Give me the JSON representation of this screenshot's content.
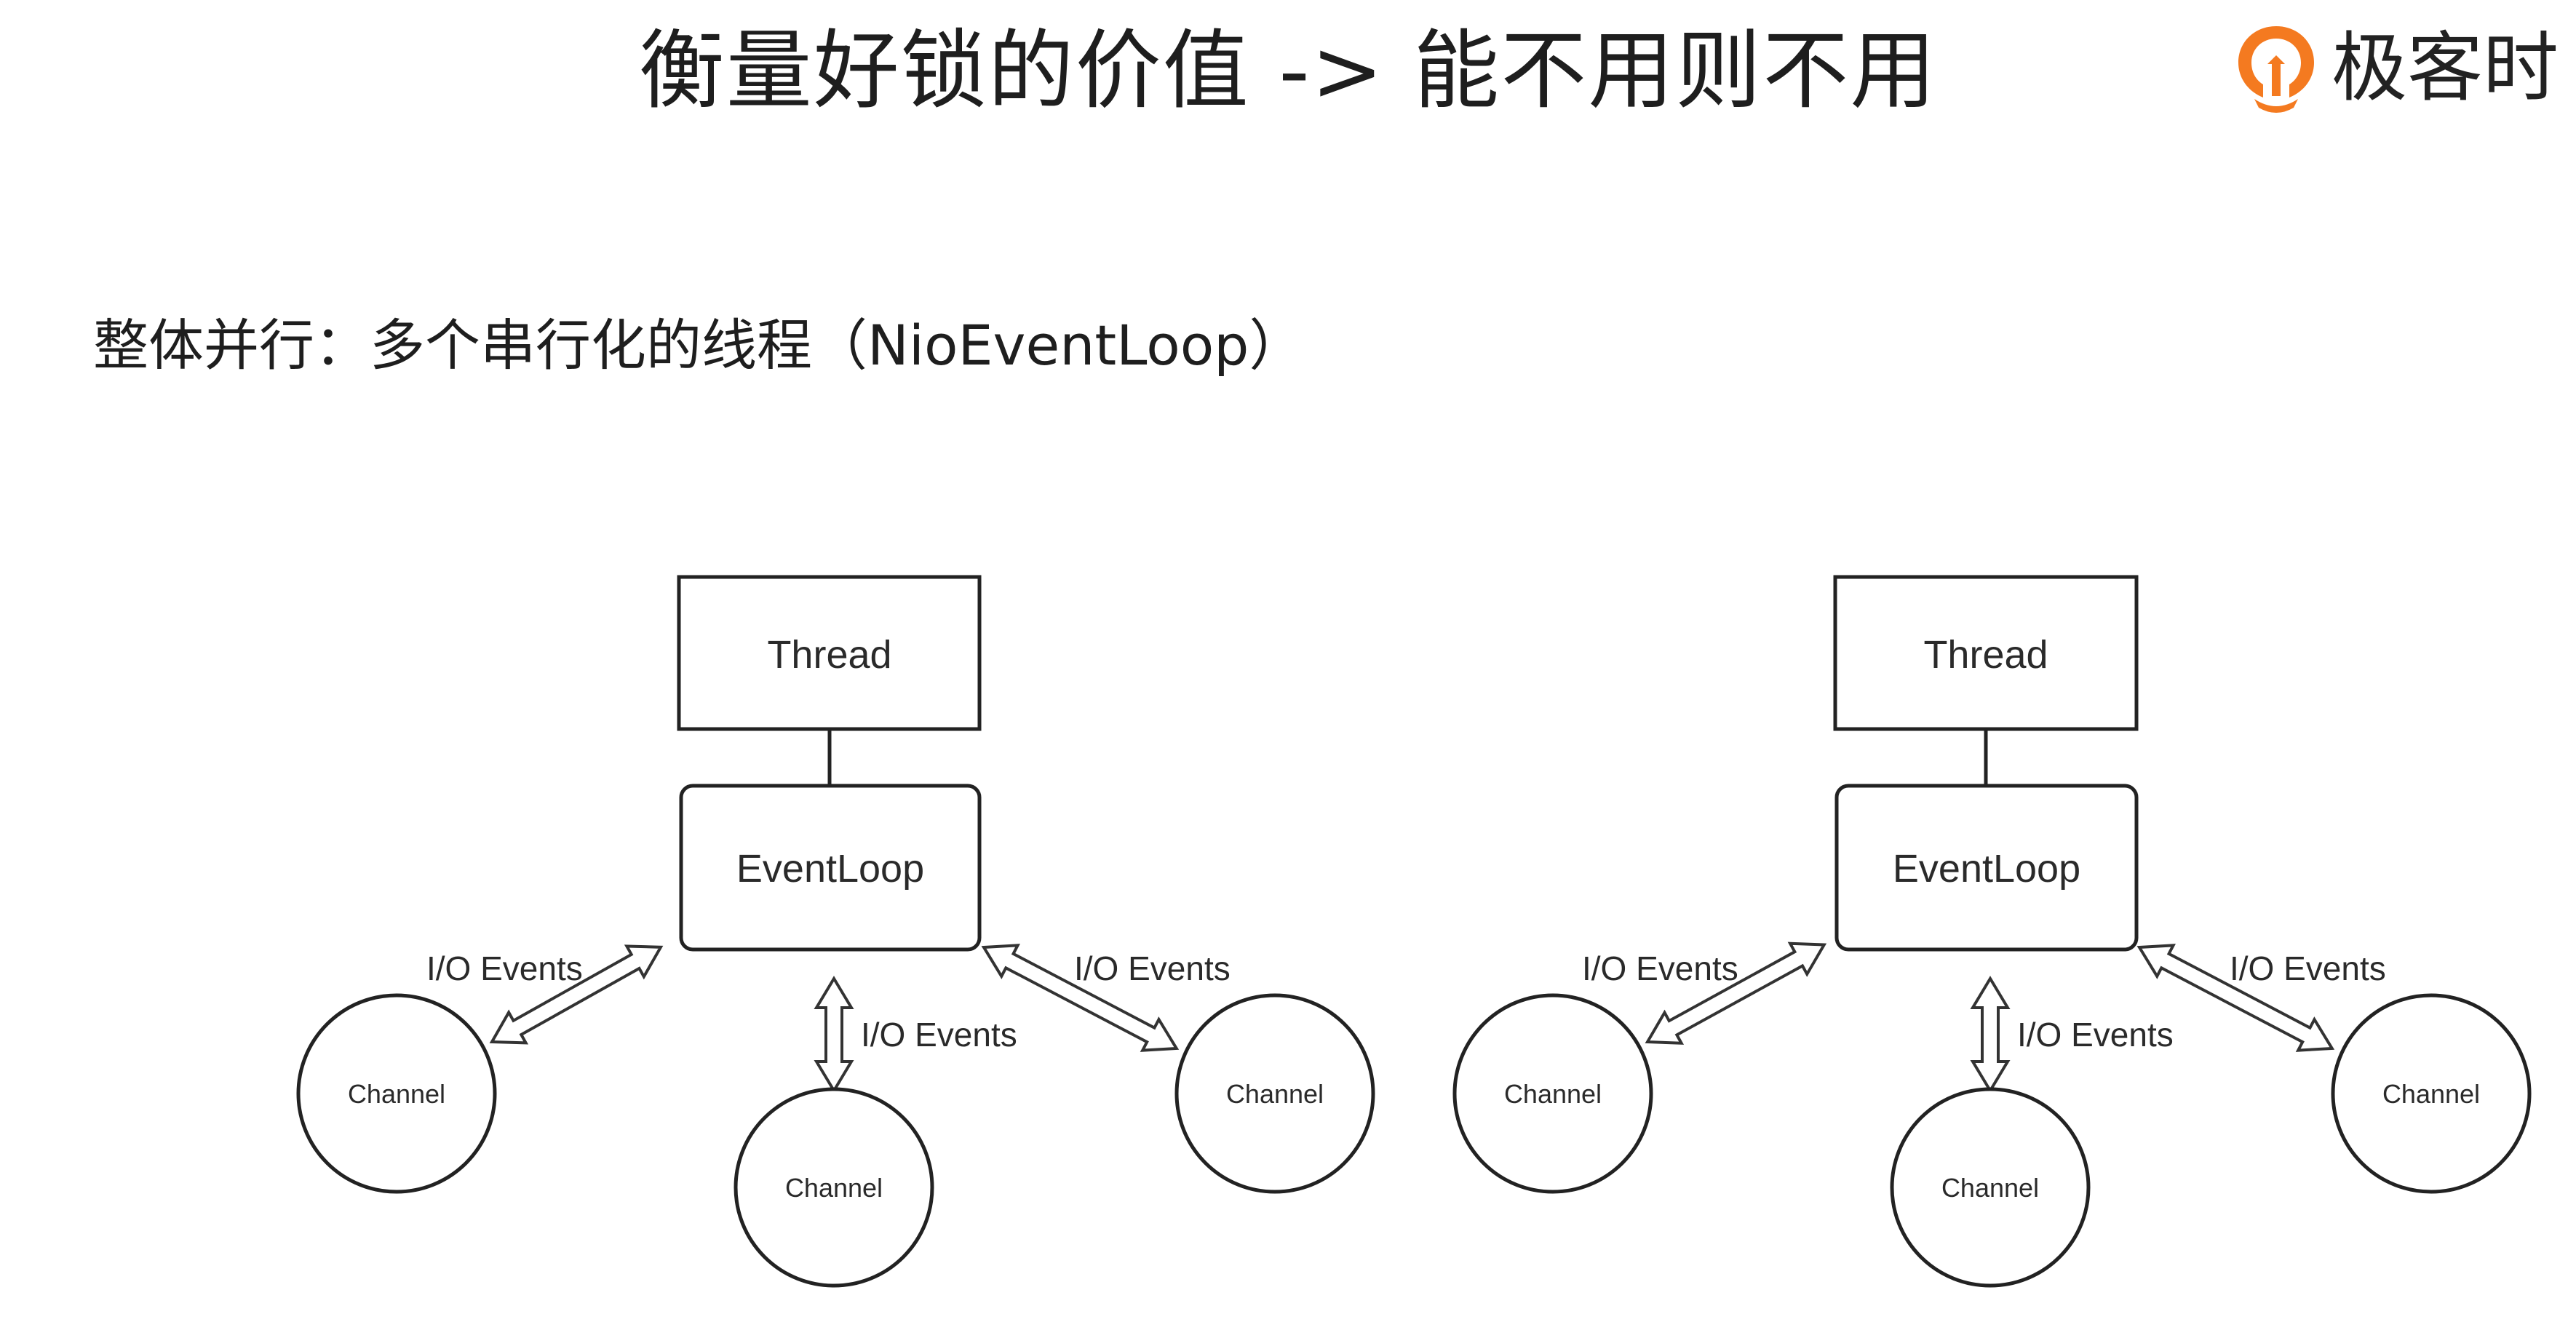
{
  "title": "衡量好锁的价值 -> 能不用则不用",
  "brand": {
    "name": "极客时",
    "icon": "geektime-logo-icon",
    "color": "#f47a20"
  },
  "subtitle": "整体并行：多个串行化的线程（NioEventLoop）",
  "diagrams": [
    {
      "thread_label": "Thread",
      "eventloop_label": "EventLoop",
      "channels": [
        "Channel",
        "Channel",
        "Channel"
      ],
      "io_labels": [
        "I/O Events",
        "I/O Events",
        "I/O Events"
      ]
    },
    {
      "thread_label": "Thread",
      "eventloop_label": "EventLoop",
      "channels": [
        "Channel",
        "Channel",
        "Channel"
      ],
      "io_labels": [
        "I/O Events",
        "I/O Events",
        "I/O Events"
      ]
    }
  ]
}
